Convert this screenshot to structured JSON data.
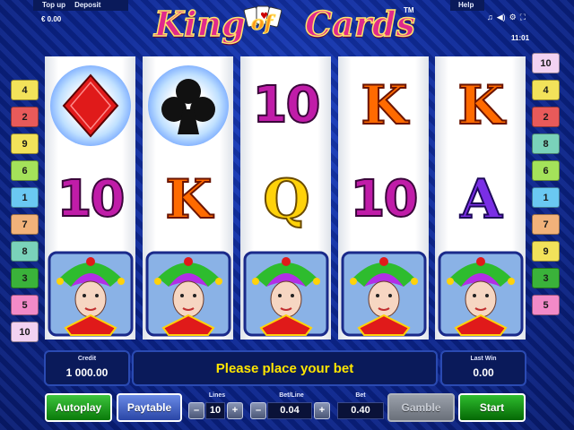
{
  "topbar": {
    "menu_left": [
      "Top up",
      "Deposit"
    ],
    "menu_right": [
      "Help"
    ],
    "balance": "€ 0.00",
    "clock": "11:01",
    "tray_icons": [
      "music-icon",
      "volume-icon",
      "settings-icon",
      "fullscreen-icon"
    ]
  },
  "logo": {
    "word1": "King",
    "word2": "of",
    "word3": "Cards",
    "tm": "TM"
  },
  "lines": {
    "left": [
      {
        "n": "4",
        "color": "#f2e25a"
      },
      {
        "n": "2",
        "color": "#e85a5a"
      },
      {
        "n": "9",
        "color": "#f2e25a"
      },
      {
        "n": "6",
        "color": "#a4e25a"
      },
      {
        "n": "1",
        "color": "#6ac8f2"
      },
      {
        "n": "7",
        "color": "#f2b27a"
      },
      {
        "n": "8",
        "color": "#7ad2ba"
      },
      {
        "n": "3",
        "color": "#3ab23a"
      },
      {
        "n": "5",
        "color": "#f28ac8"
      },
      {
        "n": "10",
        "color": "#f2d2f2"
      }
    ],
    "right": [
      {
        "n": "10",
        "color": "#f2d2f2"
      },
      {
        "n": "4",
        "color": "#f2e25a"
      },
      {
        "n": "2",
        "color": "#e85a5a"
      },
      {
        "n": "8",
        "color": "#7ad2ba"
      },
      {
        "n": "6",
        "color": "#a4e25a"
      },
      {
        "n": "1",
        "color": "#6ac8f2"
      },
      {
        "n": "7",
        "color": "#f2b27a"
      },
      {
        "n": "9",
        "color": "#f2e25a"
      },
      {
        "n": "3",
        "color": "#3ab23a"
      },
      {
        "n": "5",
        "color": "#f28ac8"
      }
    ]
  },
  "reels": [
    [
      "diamond",
      "10",
      "joker"
    ],
    [
      "club",
      "K",
      "joker"
    ],
    [
      "10",
      "Q",
      "joker"
    ],
    [
      "K",
      "10",
      "joker"
    ],
    [
      "K",
      "A",
      "joker"
    ]
  ],
  "panel": {
    "credit_label": "Credit",
    "credit_value": "1 000.00",
    "message": "Please place your bet",
    "last_win_label": "Last Win",
    "last_win_value": "0.00"
  },
  "controls": {
    "autoplay": "Autoplay",
    "paytable": "Paytable",
    "lines_label": "Lines",
    "lines_value": "10",
    "bet_line_label": "Bet/Line",
    "bet_line_value": "0.04",
    "bet_label": "Bet",
    "bet_value": "0.40",
    "gamble": "Gamble",
    "start": "Start",
    "minus": "–",
    "plus": "+"
  }
}
